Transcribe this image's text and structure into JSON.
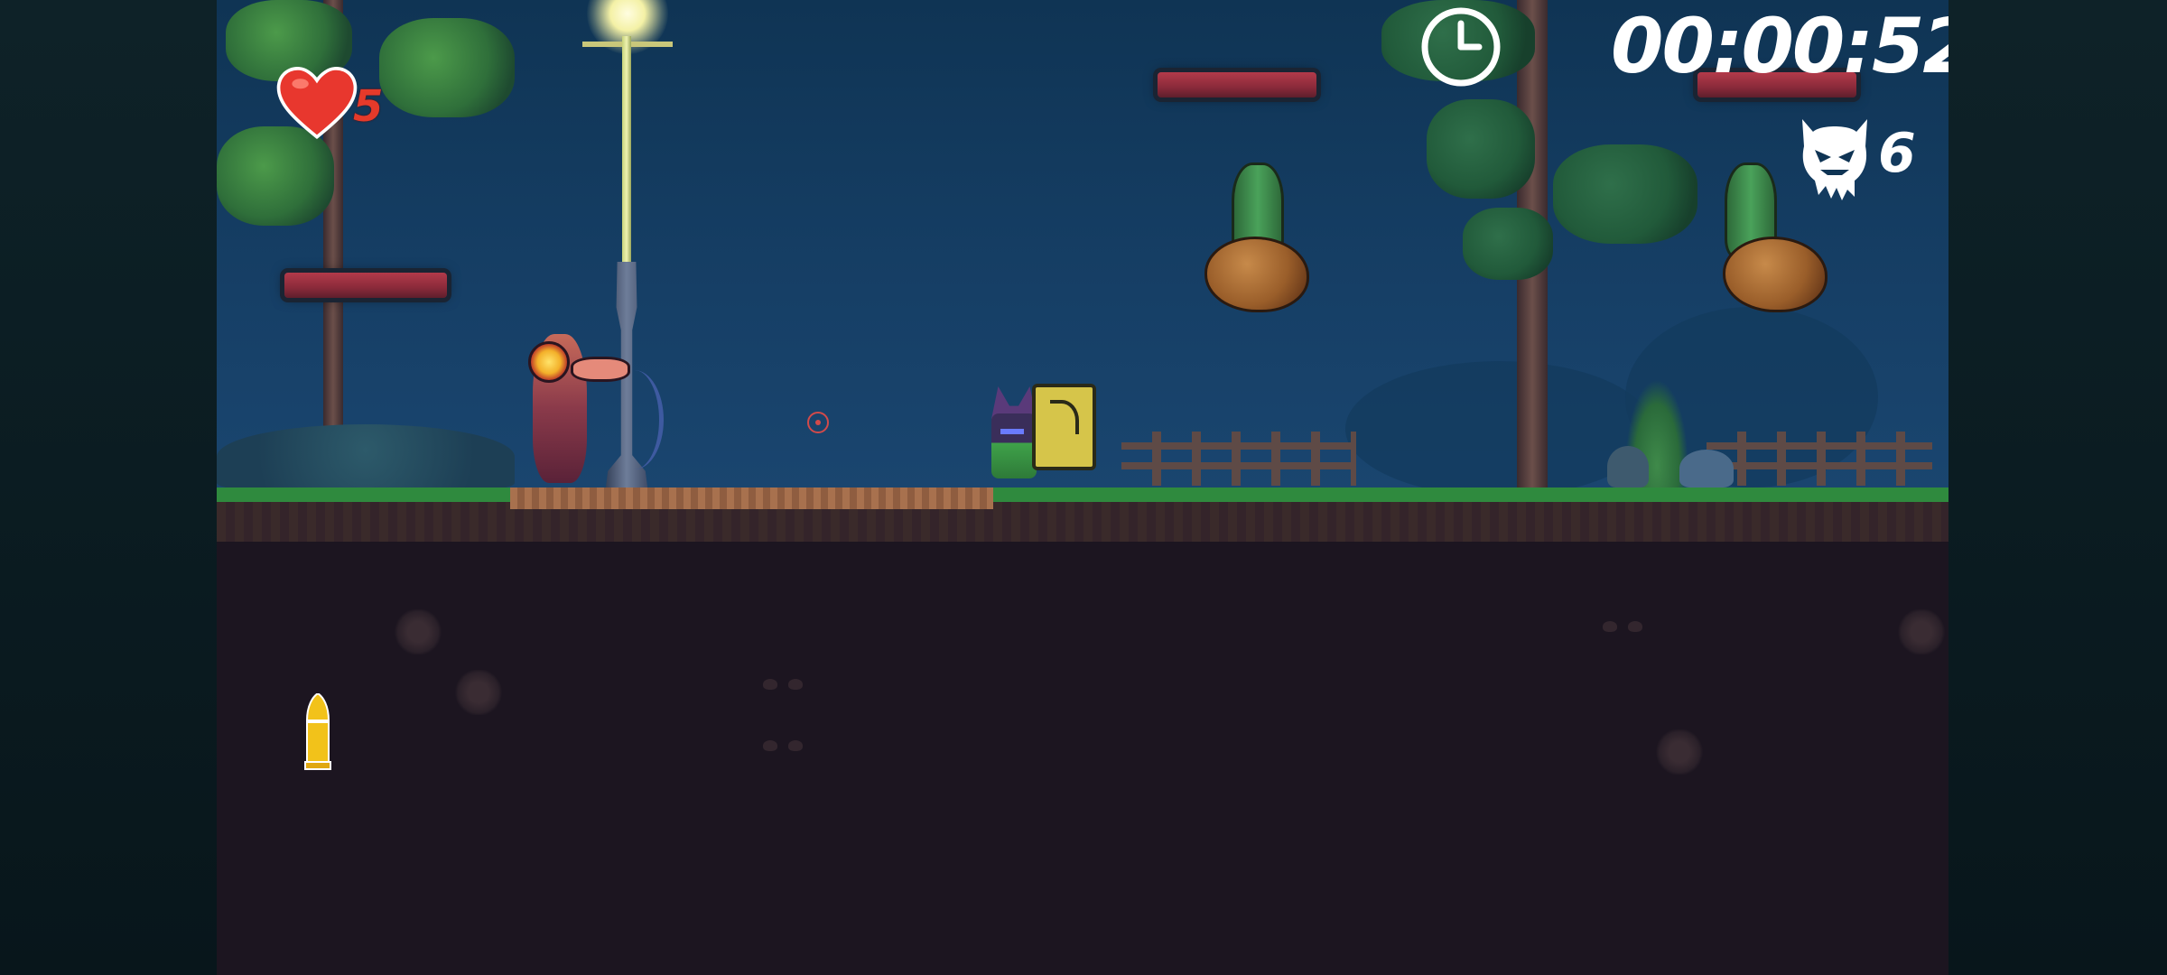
{
  "hud": {
    "lives": "5",
    "timer": "00:00:52",
    "kills": "6"
  },
  "icons": {
    "lives": "heart-icon",
    "timer": "clock-icon",
    "kills": "skull-icon",
    "ammo": "bullet-icon"
  },
  "colors": {
    "lives_text": "#e53a2a",
    "hud_text": "#ffffff",
    "platform": "#b33a4a",
    "ammo": "#f2c21a"
  }
}
